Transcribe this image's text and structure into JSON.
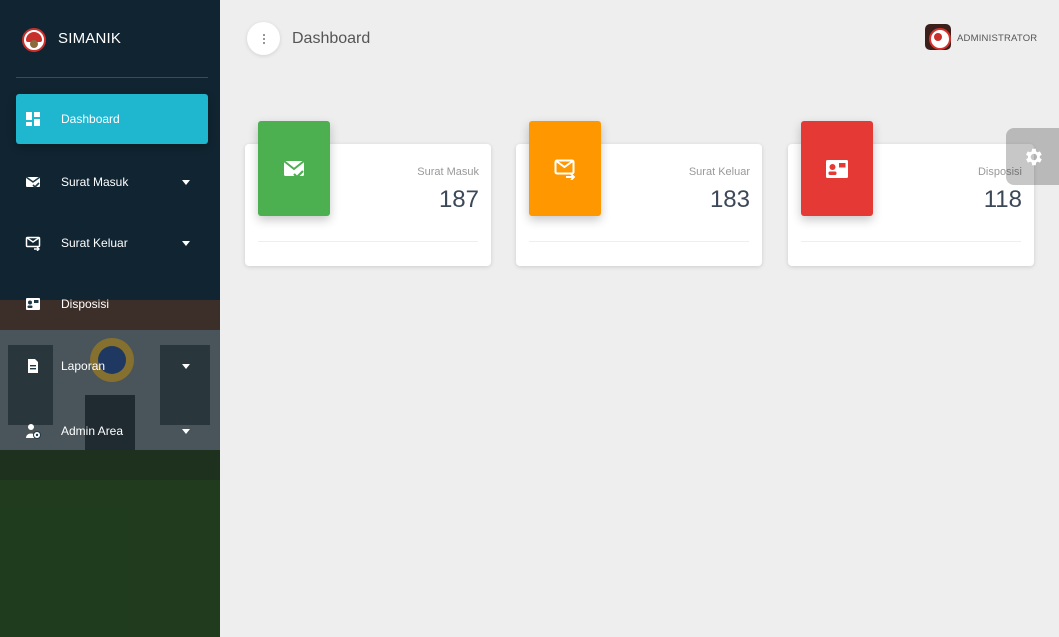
{
  "sidebar": {
    "brand": "SIMANIK",
    "items": [
      {
        "label": "Dashboard",
        "icon": "dashboard-icon",
        "active": true,
        "has_submenu": false
      },
      {
        "label": "Surat Masuk",
        "icon": "mail-check-icon",
        "active": false,
        "has_submenu": true
      },
      {
        "label": "Surat Keluar",
        "icon": "mail-out-icon",
        "active": false,
        "has_submenu": true
      },
      {
        "label": "Disposisi",
        "icon": "contact-card-icon",
        "active": false,
        "has_submenu": false
      },
      {
        "label": "Laporan",
        "icon": "file-icon",
        "active": false,
        "has_submenu": true
      },
      {
        "label": "Admin Area",
        "icon": "user-shield-icon",
        "active": false,
        "has_submenu": true
      }
    ]
  },
  "header": {
    "title": "Dashboard",
    "user": "ADMINISTRATOR"
  },
  "cards": [
    {
      "label": "Surat Masuk",
      "value": "187",
      "color": "#4caf50",
      "icon": "mail-check-icon"
    },
    {
      "label": "Surat Keluar",
      "value": "183",
      "color": "#ff9800",
      "icon": "mail-out-icon"
    },
    {
      "label": "Disposisi",
      "value": "118",
      "color": "#e53935",
      "icon": "contact-card-icon"
    }
  ],
  "colors": {
    "accent": "#1fb6cf",
    "background": "#eeeeee"
  }
}
